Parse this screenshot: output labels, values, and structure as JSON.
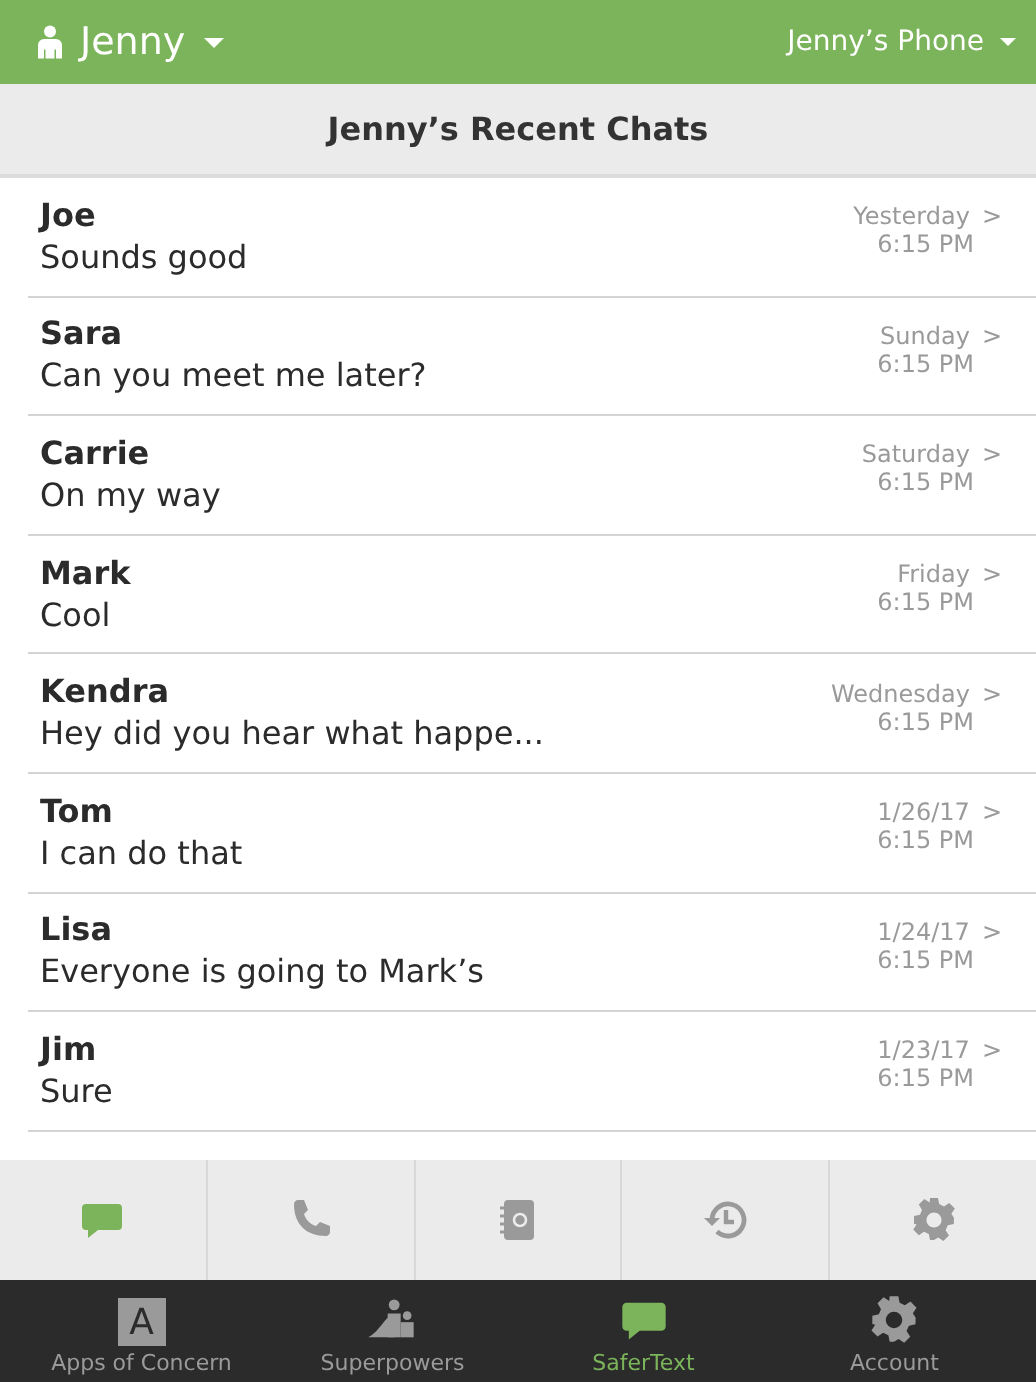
{
  "header": {
    "user": "Jenny",
    "device": "Jenny’s Phone"
  },
  "title": "Jenny’s Recent Chats",
  "chats": [
    {
      "name": "Joe",
      "message": "Sounds good",
      "day": "Yesterday",
      "time": "6:15 PM",
      "chevron": ">"
    },
    {
      "name": "Sara",
      "message": "Can you meet me later?",
      "day": "Sunday",
      "time": "6:15 PM",
      "chevron": ">"
    },
    {
      "name": "Carrie",
      "message": "On my way",
      "day": "Saturday",
      "time": "6:15 PM",
      "chevron": ">"
    },
    {
      "name": "Mark",
      "message": "Cool",
      "day": "Friday",
      "time": "6:15 PM",
      "chevron": ">"
    },
    {
      "name": "Kendra",
      "message": "Hey did you hear what happe...",
      "day": "Wednesday",
      "time": "6:15 PM",
      "chevron": ">"
    },
    {
      "name": "Tom",
      "message": "I can do that",
      "day": "1/26/17",
      "time": "6:15 PM",
      "chevron": ">"
    },
    {
      "name": "Lisa",
      "message": "Everyone is going to Mark’s",
      "day": "1/24/17",
      "time": "6:15 PM",
      "chevron": ">"
    },
    {
      "name": "Jim",
      "message": "Sure",
      "day": "1/23/17",
      "time": "6:15 PM",
      "chevron": ">"
    }
  ],
  "tabs": [
    {
      "kind": "chat",
      "selected": true
    },
    {
      "kind": "phone",
      "selected": false
    },
    {
      "kind": "contacts",
      "selected": false
    },
    {
      "kind": "history",
      "selected": false
    },
    {
      "kind": "settings",
      "selected": false
    }
  ],
  "nav": [
    {
      "kind": "apps",
      "label": "Apps of Concern",
      "icon_text": "A",
      "selected": false
    },
    {
      "kind": "superpowers",
      "label": "Superpowers",
      "selected": false
    },
    {
      "kind": "chat",
      "label": "SaferText",
      "selected": true
    },
    {
      "kind": "settings",
      "label": "Account",
      "selected": false
    }
  ]
}
